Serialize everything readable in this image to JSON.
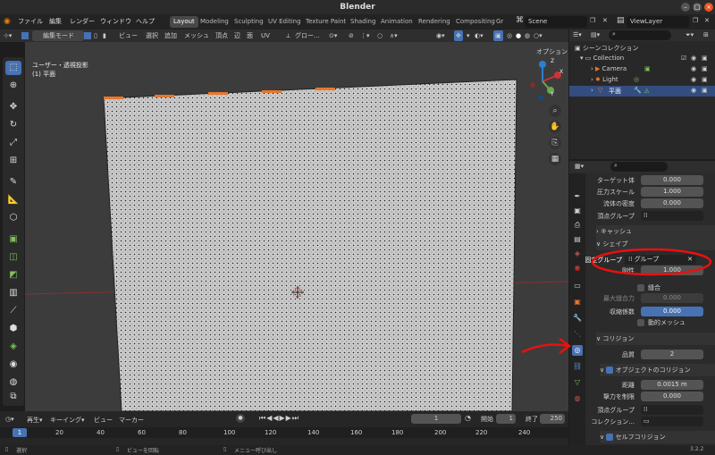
{
  "title": "Blender",
  "menus": [
    "ファイル",
    "編集",
    "レンダー",
    "ウィンドウ",
    "ヘルプ"
  ],
  "workspaces": [
    "Layout",
    "Modeling",
    "Sculpting",
    "UV Editing",
    "Texture Paint",
    "Shading",
    "Animation",
    "Rendering",
    "Compositing",
    "Gr"
  ],
  "scene": "Scene",
  "view_layer": "ViewLayer",
  "viewport_header": {
    "mode": "編集モード",
    "menus": [
      "ビュー",
      "選択",
      "追加",
      "メッシュ",
      "頂点",
      "辺",
      "面",
      "UV"
    ],
    "transform": "グロー...",
    "options": "オプション"
  },
  "viewport": {
    "view_name": "ユーザー・透視投影",
    "object_name": "(1) 平面",
    "gizmo_axes": [
      "X",
      "Y",
      "Z"
    ]
  },
  "outliner": {
    "header": "シーンコレクション",
    "items": [
      "Collection",
      "Camera",
      "Light",
      "平面"
    ]
  },
  "properties": {
    "rows_top": [
      {
        "label": "ターゲット体",
        "value": "0.000"
      },
      {
        "label": "圧力スケール",
        "value": "1.000"
      },
      {
        "label": "流体の密度",
        "value": "0.000"
      },
      {
        "label": "頂点グループ",
        "value": ""
      }
    ],
    "cache": "キャッシュ",
    "shape": "シェイプ",
    "pin_group_label": "固定グループ",
    "pin_group_value": "グループ",
    "stiffness_label": "剛性",
    "stiffness_value": "1.000",
    "sewing": "縫合",
    "max_sewing_label": "最大縫合力",
    "max_sewing_value": "0.000",
    "shrink_label": "収縮係数",
    "shrink_value": "0.000",
    "dynamic_mesh": "動的メッシュ",
    "collision": "コリジョン",
    "quality_label": "品質",
    "quality_value": "2",
    "object_collision": "オブジェクトのコリジョン",
    "distance_label": "距離",
    "distance_value": "0.0015 m",
    "impulse_label": "撃力を制限",
    "impulse_value": "0.000",
    "vertex_group_label": "頂点グループ",
    "collection_label": "コレクション...",
    "self_collision": "セルフコリジョン"
  },
  "timeline": {
    "menus": [
      "再生",
      "キーイング",
      "ビュー",
      "マーカー"
    ],
    "current_frame": "1",
    "start_label": "開始",
    "start": "1",
    "end_label": "終了",
    "end": "250",
    "ticks": [
      "1",
      "20",
      "40",
      "60",
      "80",
      "100",
      "120",
      "140",
      "160",
      "180",
      "200",
      "220",
      "240"
    ]
  },
  "status": {
    "select": "選択",
    "rotate": "ビューを回転",
    "menu": "メニュー呼び出し",
    "version": "3.2.2"
  },
  "colors": {
    "accent": "#4772b3",
    "annotation": "#e81010"
  }
}
